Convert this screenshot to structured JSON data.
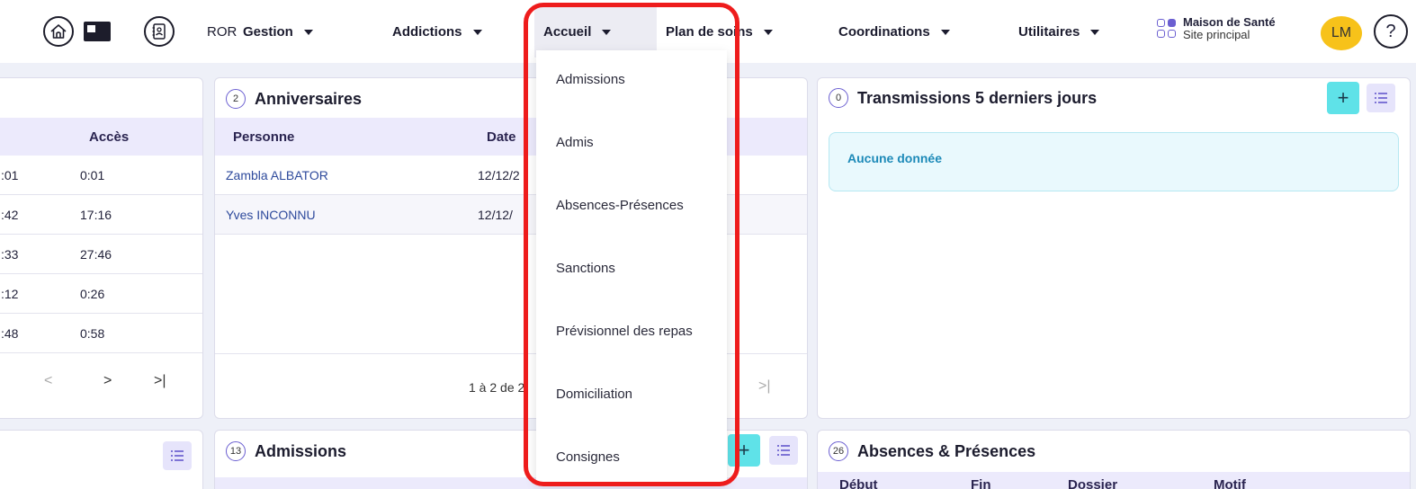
{
  "nav": {
    "ror": "ROR",
    "items": [
      {
        "label": "Gestion"
      },
      {
        "label": "Addictions"
      },
      {
        "label": "Accueil"
      },
      {
        "label": "Plan de soins"
      },
      {
        "label": "Coordinations"
      },
      {
        "label": "Utilitaires"
      }
    ],
    "site_name": "Maison de Santé",
    "site_sub": "Site principal",
    "avatar": "LM",
    "help": "?"
  },
  "accueil_menu": [
    "Admissions",
    "Admis",
    "Absences-Présences",
    "Sanctions",
    "Prévisionnel des repas",
    "Domiciliation",
    "Consignes"
  ],
  "left_card": {
    "col_acces": "Accès",
    "rows": [
      {
        "c1": ":01",
        "c2": "0:01"
      },
      {
        "c1": ":42",
        "c2": "17:16"
      },
      {
        "c1": ":33",
        "c2": "27:46"
      },
      {
        "c1": ":12",
        "c2": "0:26"
      },
      {
        "c1": ":48",
        "c2": "0:58"
      }
    ],
    "pager_prev": "<",
    "pager_next": ">",
    "pager_last": ">|"
  },
  "anniversaires": {
    "count": "2",
    "title": "Anniversaires",
    "col_person": "Personne",
    "col_date": "Date",
    "rows": [
      {
        "name": "Zambla ALBATOR",
        "date": "12/12/2"
      },
      {
        "name": "Yves INCONNU",
        "date": "12/12/"
      }
    ],
    "pager_text": "1 à 2 de 2",
    "pager_last": ">|"
  },
  "transmissions": {
    "count": "0",
    "title": "Transmissions 5 derniers jours",
    "plus": "+",
    "empty": "Aucune donnée"
  },
  "admissions": {
    "count": "13",
    "title": "Admissions"
  },
  "absences": {
    "count": "26",
    "title": "Absences & Présences",
    "cols": [
      "Début",
      "Fin",
      "Dossier",
      "Motif"
    ]
  },
  "colors": {
    "accent": "#6b5fd1",
    "cyan": "#5fe2e8",
    "highlight": "#ee1c1c",
    "avatar": "#f7c21a"
  }
}
